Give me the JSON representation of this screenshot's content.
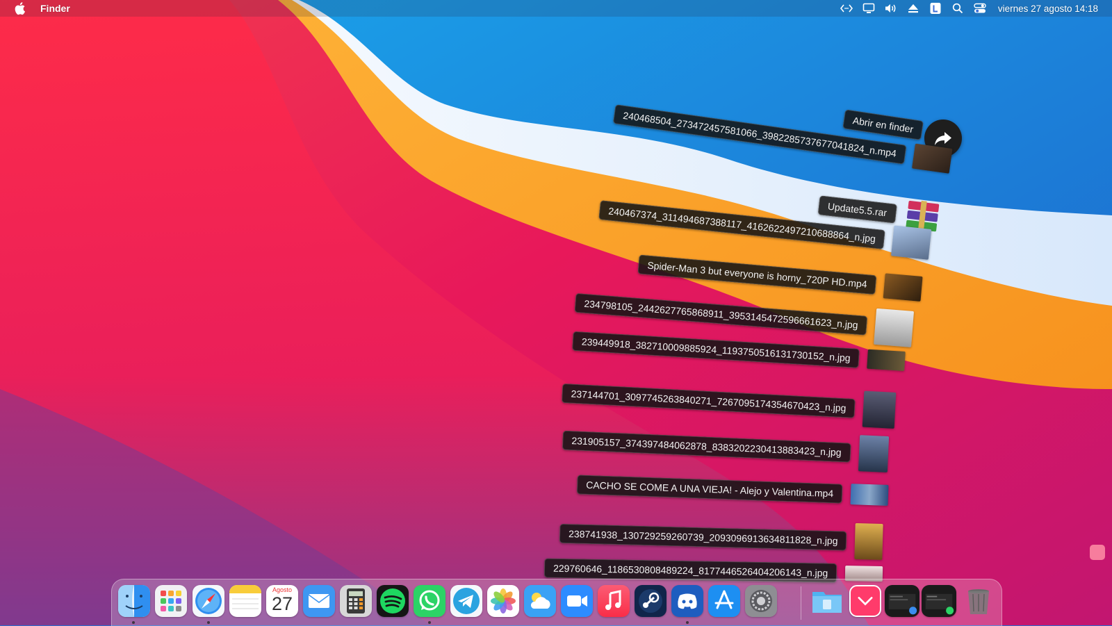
{
  "menubar": {
    "app_name": "Finder",
    "clock": "viernes 27 agosto 14:18",
    "status_icons": [
      "code-icon",
      "display-icon",
      "volume-icon",
      "eject-icon",
      "input-source-icon",
      "spotlight-icon",
      "control-center-icon"
    ]
  },
  "stack": {
    "open_in_finder_label": "Abrir en finder",
    "items": [
      {
        "name": "240468504_273472457581066_3982285737677041824_n.mp4",
        "thumb_color": "#3a2d22"
      },
      {
        "name": "Update5.5.rar",
        "thumb_color": "#c23a6a"
      },
      {
        "name": "240467374_311494687388117_4162622497210688864_n.jpg",
        "thumb_color": "#7f95b8"
      },
      {
        "name": "Spider-Man 3 but everyone is horny_720P HD.mp4",
        "thumb_color": "#5a3a18"
      },
      {
        "name": "234798105_2442627765868911_3953145472596661623_n.jpg",
        "thumb_color": "#c9c9c9"
      },
      {
        "name": "239449918_382710009885924_1193750516131730152_n.jpg",
        "thumb_color": "#3b3b2f"
      },
      {
        "name": "237144701_3097745263840271_7267095174354670423_n.jpg",
        "thumb_color": "#3c3f52"
      },
      {
        "name": "231905157_374397484062878_8383202230413883423_n.jpg",
        "thumb_color": "#3e4d66"
      },
      {
        "name": "CACHO SE COME A UNA VIEJA! - Alejo y Valentina.mp4",
        "thumb_color": "#4f79b0"
      },
      {
        "name": "238741938_130729259260739_2093096913634811828_n.jpg",
        "thumb_color": "#b8862e"
      },
      {
        "name": "229760646_1186530808489224_8177446526404206143_n.jpg",
        "thumb_color": "#d9c8c8"
      }
    ]
  },
  "dock": {
    "calendar_month": "Agosto",
    "calendar_day": "27",
    "apps": [
      "finder-icon",
      "launchpad-icon",
      "safari-icon",
      "notes-icon",
      "calendar-icon",
      "mail-icon",
      "calculator-icon",
      "spotify-icon",
      "whatsapp-icon",
      "telegram-icon",
      "photos-icon",
      "weather-icon",
      "zoom-icon",
      "music-icon",
      "steam-icon",
      "discord-icon",
      "app-store-icon",
      "system-preferences-icon"
    ],
    "right": [
      "downloads-folder-icon",
      "stack-chevron-icon",
      "minimized-window-1",
      "minimized-window-2",
      "trash-icon"
    ]
  }
}
